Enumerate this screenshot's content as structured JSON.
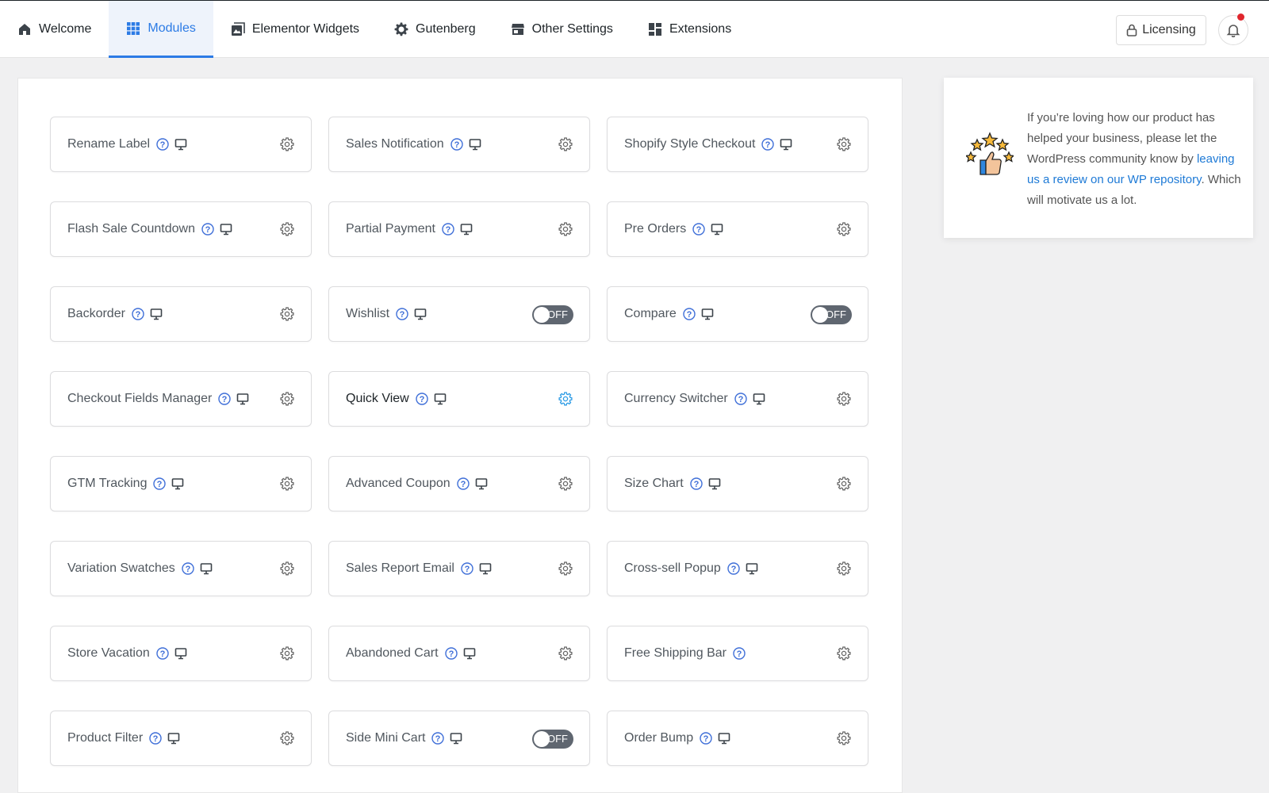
{
  "nav": {
    "tabs": [
      {
        "label": "Welcome",
        "icon": "home-icon",
        "active": false
      },
      {
        "label": "Modules",
        "icon": "grid-icon",
        "active": true
      },
      {
        "label": "Elementor Widgets",
        "icon": "widgets-icon",
        "active": false
      },
      {
        "label": "Gutenberg",
        "icon": "gear-icon",
        "active": false
      },
      {
        "label": "Other Settings",
        "icon": "store-icon",
        "active": false
      },
      {
        "label": "Extensions",
        "icon": "extensions-icon",
        "active": false
      }
    ],
    "licensing_label": "Licensing",
    "notification_dot": true
  },
  "modules": [
    {
      "label": "Rename Label",
      "help": true,
      "monitor": true,
      "control": "gear"
    },
    {
      "label": "Sales Notification",
      "help": true,
      "monitor": true,
      "control": "gear"
    },
    {
      "label": "Shopify Style Checkout",
      "help": true,
      "monitor": true,
      "control": "gear"
    },
    {
      "label": "Flash Sale Countdown",
      "help": true,
      "monitor": true,
      "control": "gear"
    },
    {
      "label": "Partial Payment",
      "help": true,
      "monitor": true,
      "control": "gear"
    },
    {
      "label": "Pre Orders",
      "help": true,
      "monitor": true,
      "control": "gear"
    },
    {
      "label": "Backorder",
      "help": true,
      "monitor": true,
      "control": "gear"
    },
    {
      "label": "Wishlist",
      "help": true,
      "monitor": true,
      "control": "toggle",
      "toggle_label": "OFF"
    },
    {
      "label": "Compare",
      "help": true,
      "monitor": true,
      "control": "toggle",
      "toggle_label": "OFF"
    },
    {
      "label": "Checkout Fields Manager",
      "help": true,
      "monitor": true,
      "control": "gear"
    },
    {
      "label": "Quick View",
      "help": true,
      "monitor": true,
      "control": "gear",
      "highlight": true
    },
    {
      "label": "Currency Switcher",
      "help": true,
      "monitor": true,
      "control": "gear"
    },
    {
      "label": "GTM Tracking",
      "help": true,
      "monitor": true,
      "control": "gear"
    },
    {
      "label": "Advanced Coupon",
      "help": true,
      "monitor": true,
      "control": "gear"
    },
    {
      "label": "Size Chart",
      "help": true,
      "monitor": true,
      "control": "gear"
    },
    {
      "label": "Variation Swatches",
      "help": true,
      "monitor": true,
      "control": "gear"
    },
    {
      "label": "Sales Report Email",
      "help": true,
      "monitor": true,
      "control": "gear"
    },
    {
      "label": "Cross-sell Popup",
      "help": true,
      "monitor": true,
      "control": "gear"
    },
    {
      "label": "Store Vacation",
      "help": true,
      "monitor": true,
      "control": "gear"
    },
    {
      "label": "Abandoned Cart",
      "help": true,
      "monitor": true,
      "control": "gear"
    },
    {
      "label": "Free Shipping Bar",
      "help": true,
      "monitor": false,
      "control": "gear"
    },
    {
      "label": "Product Filter",
      "help": true,
      "monitor": true,
      "control": "gear"
    },
    {
      "label": "Side Mini Cart",
      "help": true,
      "monitor": true,
      "control": "toggle",
      "toggle_label": "OFF"
    },
    {
      "label": "Order Bump",
      "help": true,
      "monitor": true,
      "control": "gear"
    }
  ],
  "review": {
    "text_before": "If you’re loving how our product has helped your business, please let the WordPress community know by ",
    "link_text": "leaving us a review on our WP repository",
    "text_after": ". Which will motivate us a lot.",
    "illustration": "thumbs-up-stars-icon"
  },
  "colors": {
    "accent": "#2c7be5",
    "toggle_off": "#5f6670",
    "notification": "#e0262d",
    "link": "#1e7ad6"
  }
}
